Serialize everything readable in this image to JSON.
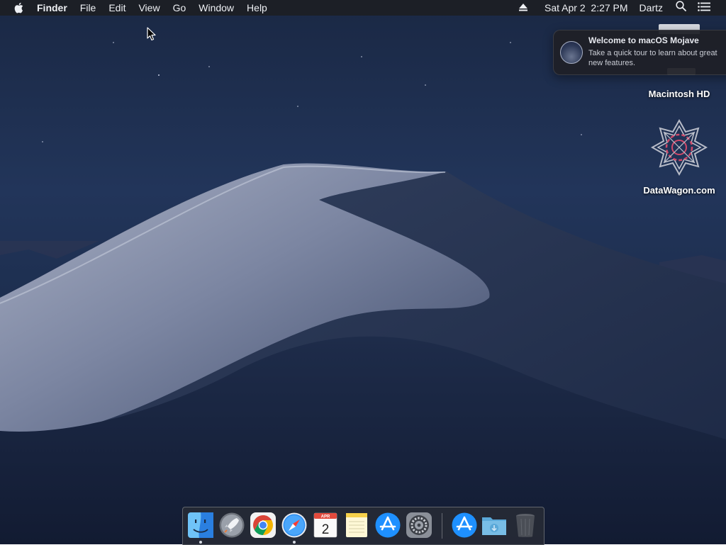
{
  "menubar": {
    "apple_icon": "apple-logo-icon",
    "app_name": "Finder",
    "menus": [
      "File",
      "Edit",
      "View",
      "Go",
      "Window",
      "Help"
    ],
    "eject_icon": "eject-icon",
    "datetime": "Sat Apr 2  2:27 PM",
    "user": "Dartz",
    "spotlight_icon": "magnifier-icon",
    "notification_center_icon": "list-icon"
  },
  "notification": {
    "title": "Welcome to macOS Mojave",
    "body": "Take a quick tour to learn about great new features."
  },
  "desktop_icons": [
    {
      "label": "Macintosh HD",
      "icon": "hard-drive-icon"
    },
    {
      "label": "DataWagon.com",
      "icon": "datawagon-logo-icon"
    }
  ],
  "calendar_icon": {
    "month": "APR",
    "day": "2"
  },
  "dock": {
    "apps": [
      "Finder",
      "Launchpad",
      "Google Chrome",
      "Safari",
      "Calendar",
      "Notes",
      "App Store",
      "System Preferences"
    ],
    "running": [
      "Finder",
      "Safari"
    ],
    "stacks": [
      "App Store",
      "Downloads",
      "Trash"
    ]
  },
  "colors": {
    "menubar_bg": "#1c1e24",
    "desktop_sky": "#1a2844",
    "dune_light": "#9aa2b8",
    "accent_blue": "#1e90ff"
  }
}
